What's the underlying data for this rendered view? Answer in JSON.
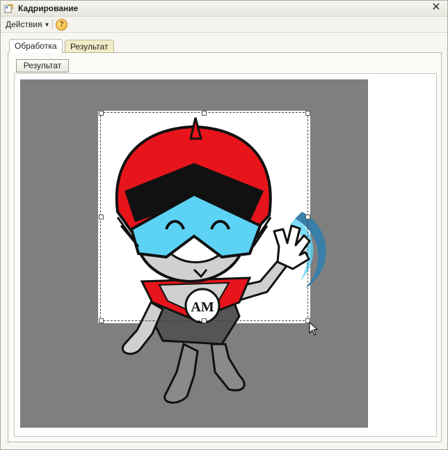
{
  "window": {
    "title": "Кадрирование"
  },
  "commandbar": {
    "actions_label": "Действия",
    "help_label": "?"
  },
  "tabs": [
    {
      "label": "Обработка"
    },
    {
      "label": "Результат"
    }
  ],
  "toolbar": {
    "result_button": "Результат"
  },
  "image": {
    "badge_text": "АМ"
  },
  "colors": {
    "canvas_bg": "#7f7f7f",
    "helmet_red": "#e8141b",
    "visor_blue": "#5cd3f5",
    "accent_blue": "#3a7fa8"
  }
}
